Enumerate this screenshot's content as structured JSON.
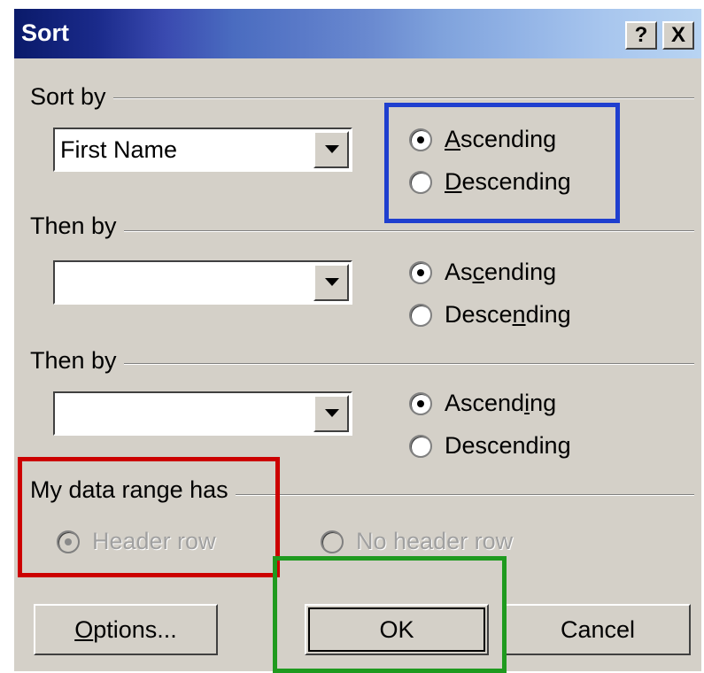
{
  "dialog": {
    "title": "Sort",
    "help_label": "?",
    "close_label": "X"
  },
  "sort_by": {
    "label": "Sort by",
    "field_value": "First Name",
    "ascending_label": "Ascending",
    "descending_label": "Descending",
    "order": "ascending"
  },
  "then_by_1": {
    "label": "Then by",
    "field_value": "",
    "ascending_label": "Ascending",
    "descending_label": "Descending",
    "order": "ascending"
  },
  "then_by_2": {
    "label": "Then by",
    "field_value": "",
    "ascending_label": "Ascending",
    "descending_label": "Descending",
    "order": "ascending"
  },
  "data_range": {
    "label": "My data range has",
    "header_row_label": "Header row",
    "no_header_row_label": "No header row",
    "selected": "header_row",
    "enabled": false
  },
  "buttons": {
    "options_label": "Options...",
    "ok_label": "OK",
    "cancel_label": "Cancel"
  },
  "annotations": {
    "blue": "#1f3fcf",
    "red": "#cc0000",
    "green": "#1f9a1f"
  }
}
